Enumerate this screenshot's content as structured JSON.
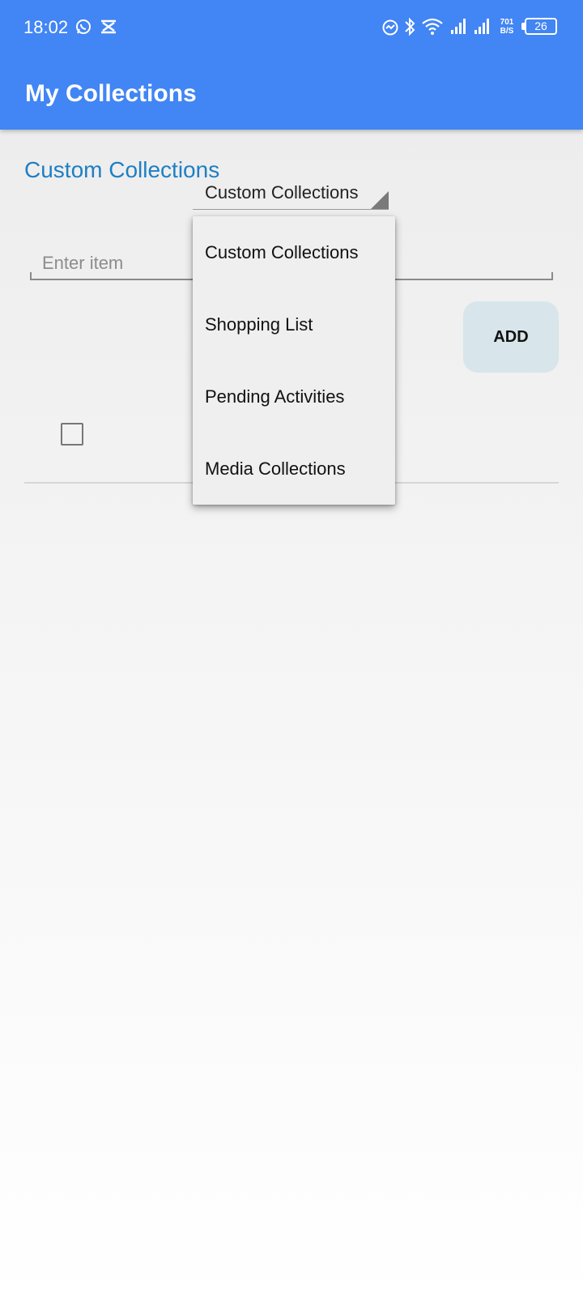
{
  "status_bar": {
    "time": "18:02",
    "notification_icons": [
      "whatsapp-icon",
      "capcut-icon"
    ],
    "system_icons": [
      "data-saver-icon",
      "bluetooth-icon",
      "wifi-icon",
      "signal-icon",
      "signal-icon"
    ],
    "net_speed_value": "701",
    "net_speed_unit": "B/S",
    "battery_level": "26"
  },
  "app_bar": {
    "title": "My Collections",
    "color": "#4285f4"
  },
  "section": {
    "title": "Custom Collections",
    "title_color": "#1e7fc4"
  },
  "spinner": {
    "selected": "Custom Collections",
    "options": [
      "Custom Collections",
      "Shopping List",
      "Pending Activities",
      "Media Collections"
    ]
  },
  "item_input": {
    "value": "",
    "placeholder": "Enter item"
  },
  "add_button": {
    "label": "ADD",
    "background": "#d8e5ea"
  },
  "list": {
    "items": [
      {
        "checked": false,
        "text": ""
      }
    ]
  }
}
